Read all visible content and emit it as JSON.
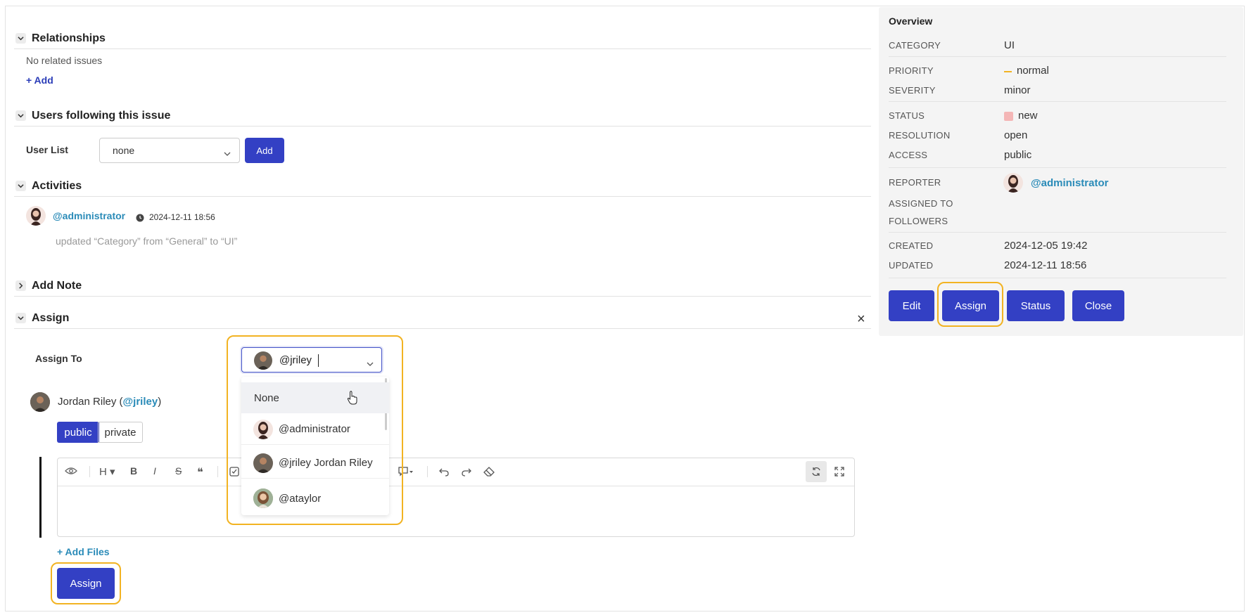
{
  "relationships": {
    "title": "Relationships",
    "empty_text": "No related issues",
    "add_label": "+ Add"
  },
  "followers": {
    "title": "Users following this issue",
    "user_list_label": "User List",
    "select_value": "none",
    "add_button": "Add"
  },
  "activities": {
    "title": "Activities",
    "entries": [
      {
        "user": "@administrator",
        "time": "2024-12-11 18:56",
        "text": "updated “Category” from “General” to “UI”"
      }
    ]
  },
  "add_note": {
    "title": "Add Note"
  },
  "assign": {
    "title": "Assign",
    "close_icon": "×",
    "assign_to_label": "Assign To",
    "input_value": "@jriley",
    "selected_user_name": "Jordan Riley (",
    "selected_user_handle": "@jriley",
    "selected_user_close": ")",
    "visibility": {
      "public": "public",
      "private": "private"
    },
    "add_files": "+ Add Files",
    "submit_button": "Assign",
    "dropdown_options": [
      {
        "label": "None",
        "avatar": false
      },
      {
        "label": "@administrator",
        "avatar": true
      },
      {
        "label": "@jriley Jordan Riley",
        "avatar": true
      },
      {
        "label": "@ataylor",
        "avatar": true
      }
    ],
    "editor_toolbar": [
      "eye-icon",
      "heading-icon",
      "bold-icon",
      "italic-icon",
      "strikethrough-icon",
      "quote-icon",
      "checkbox-icon",
      "comment-icon",
      "undo-icon",
      "redo-icon",
      "eraser-icon",
      "sync-icon",
      "fullscreen-icon"
    ],
    "toolbar_glyphs": {
      "heading": "H",
      "bold": "B",
      "italic": "I",
      "strike": "S",
      "quote": "❝"
    }
  },
  "overview": {
    "title": "Overview",
    "category_label": "CATEGORY",
    "category": "UI",
    "priority_label": "PRIORITY",
    "priority": "normal",
    "severity_label": "SEVERITY",
    "severity": "minor",
    "status_label": "STATUS",
    "status": "new",
    "resolution_label": "RESOLUTION",
    "resolution": "open",
    "access_label": "ACCESS",
    "access": "public",
    "reporter_label": "REPORTER",
    "reporter": "@administrator",
    "assigned_label": "ASSIGNED TO",
    "followers_label": "FOLLOWERS",
    "created_label": "CREATED",
    "created": "2024-12-05 19:42",
    "updated_label": "UPDATED",
    "updated": "2024-12-11 18:56",
    "buttons": {
      "edit": "Edit",
      "assign": "Assign",
      "status": "Status",
      "close": "Close"
    }
  },
  "colors": {
    "primary": "#3340c4",
    "link": "#2a8bb8",
    "highlight": "#f2b322",
    "priority_dash": "#f2b322",
    "status_swatch": "#f4b6b6"
  }
}
